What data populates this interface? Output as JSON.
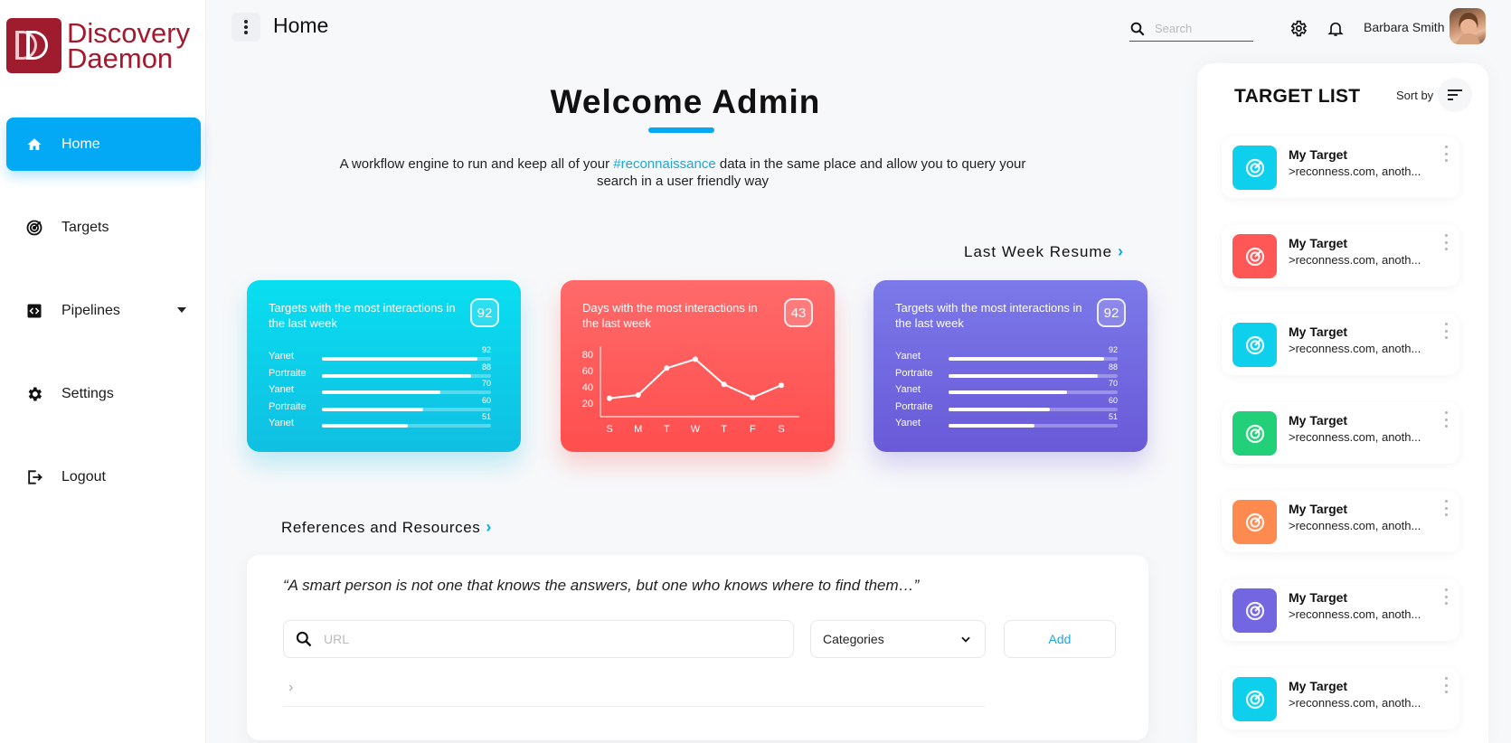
{
  "app": {
    "logo_line1": "Discovery",
    "logo_line2": "Daemon"
  },
  "sidebar": {
    "items": [
      {
        "label": "Home",
        "icon": "home-icon"
      },
      {
        "label": "Targets",
        "icon": "target-icon"
      },
      {
        "label": "Pipelines",
        "icon": "code-icon"
      },
      {
        "label": "Settings",
        "icon": "gear-icon"
      },
      {
        "label": "Logout",
        "icon": "logout-icon"
      }
    ]
  },
  "header": {
    "title": "Home",
    "search_placeholder": "Search",
    "user_name": "Barbara Smith"
  },
  "welcome": {
    "title": "Welcome Admin",
    "intro_before": "A workflow engine to run and keep all of your ",
    "intro_highlight": "#reconnaissance",
    "intro_after": " data in the same place and allow you to query your search in a user friendly way"
  },
  "resume": {
    "label": "Last Week Resume"
  },
  "cards": [
    {
      "title": "Targets with the most interactions in the last week",
      "badge": "92",
      "bars": [
        {
          "label": "Yanet",
          "value": 92
        },
        {
          "label": "Portraite",
          "value": 88
        },
        {
          "label": "Yanet",
          "value": 70
        },
        {
          "label": "Portraite",
          "value": 60
        },
        {
          "label": "Yanet",
          "value": 51
        }
      ]
    },
    {
      "title": "Days with the most interactions in the last week",
      "badge": "43"
    },
    {
      "title": "Targets with the most interactions in the last week",
      "badge": "92",
      "bars": [
        {
          "label": "Yanet",
          "value": 92
        },
        {
          "label": "Portraite",
          "value": 88
        },
        {
          "label": "Yanet",
          "value": 70
        },
        {
          "label": "Portraite",
          "value": 60
        },
        {
          "label": "Yanet",
          "value": 51
        }
      ]
    }
  ],
  "chart_data": {
    "type": "line",
    "categories": [
      "S",
      "M",
      "T",
      "W",
      "T",
      "F",
      "S"
    ],
    "values": [
      26,
      30,
      63,
      74,
      43,
      27,
      42
    ],
    "yticks": [
      "80",
      "60",
      "40",
      "20"
    ],
    "ylim": [
      10,
      90
    ],
    "grid": false
  },
  "references": {
    "heading": "References and Resources",
    "quote": "“A smart person is not one that knows the answers,  but one who knows where to find them…”",
    "url_placeholder": "URL",
    "category_value": "Categories",
    "add_label": "Add"
  },
  "target_list": {
    "title": "TARGET LIST",
    "sort_label": "Sort by",
    "items": [
      {
        "name": "My Target",
        "desc": ">reconness.com, anoth...",
        "color": "#0fd0ec"
      },
      {
        "name": "My Target",
        "desc": ">reconness.com, anoth...",
        "color": "#ff5656"
      },
      {
        "name": "My Target",
        "desc": ">reconness.com, anoth...",
        "color": "#0fd0ec"
      },
      {
        "name": "My Target",
        "desc": ">reconness.com, anoth...",
        "color": "#23d07a"
      },
      {
        "name": "My Target",
        "desc": ">reconness.com, anoth...",
        "color": "#ff8a50"
      },
      {
        "name": "My Target",
        "desc": ">reconness.com, anoth...",
        "color": "#7466e0"
      },
      {
        "name": "My Target",
        "desc": ">reconness.com, anoth...",
        "color": "#0fd0ec"
      }
    ]
  },
  "colors": {
    "accent": "#03a9f4",
    "brand": "#a3192d",
    "card_cyan": "#10bfe2",
    "card_red": "#ff4e4e",
    "card_purple": "#6a5ad8"
  }
}
